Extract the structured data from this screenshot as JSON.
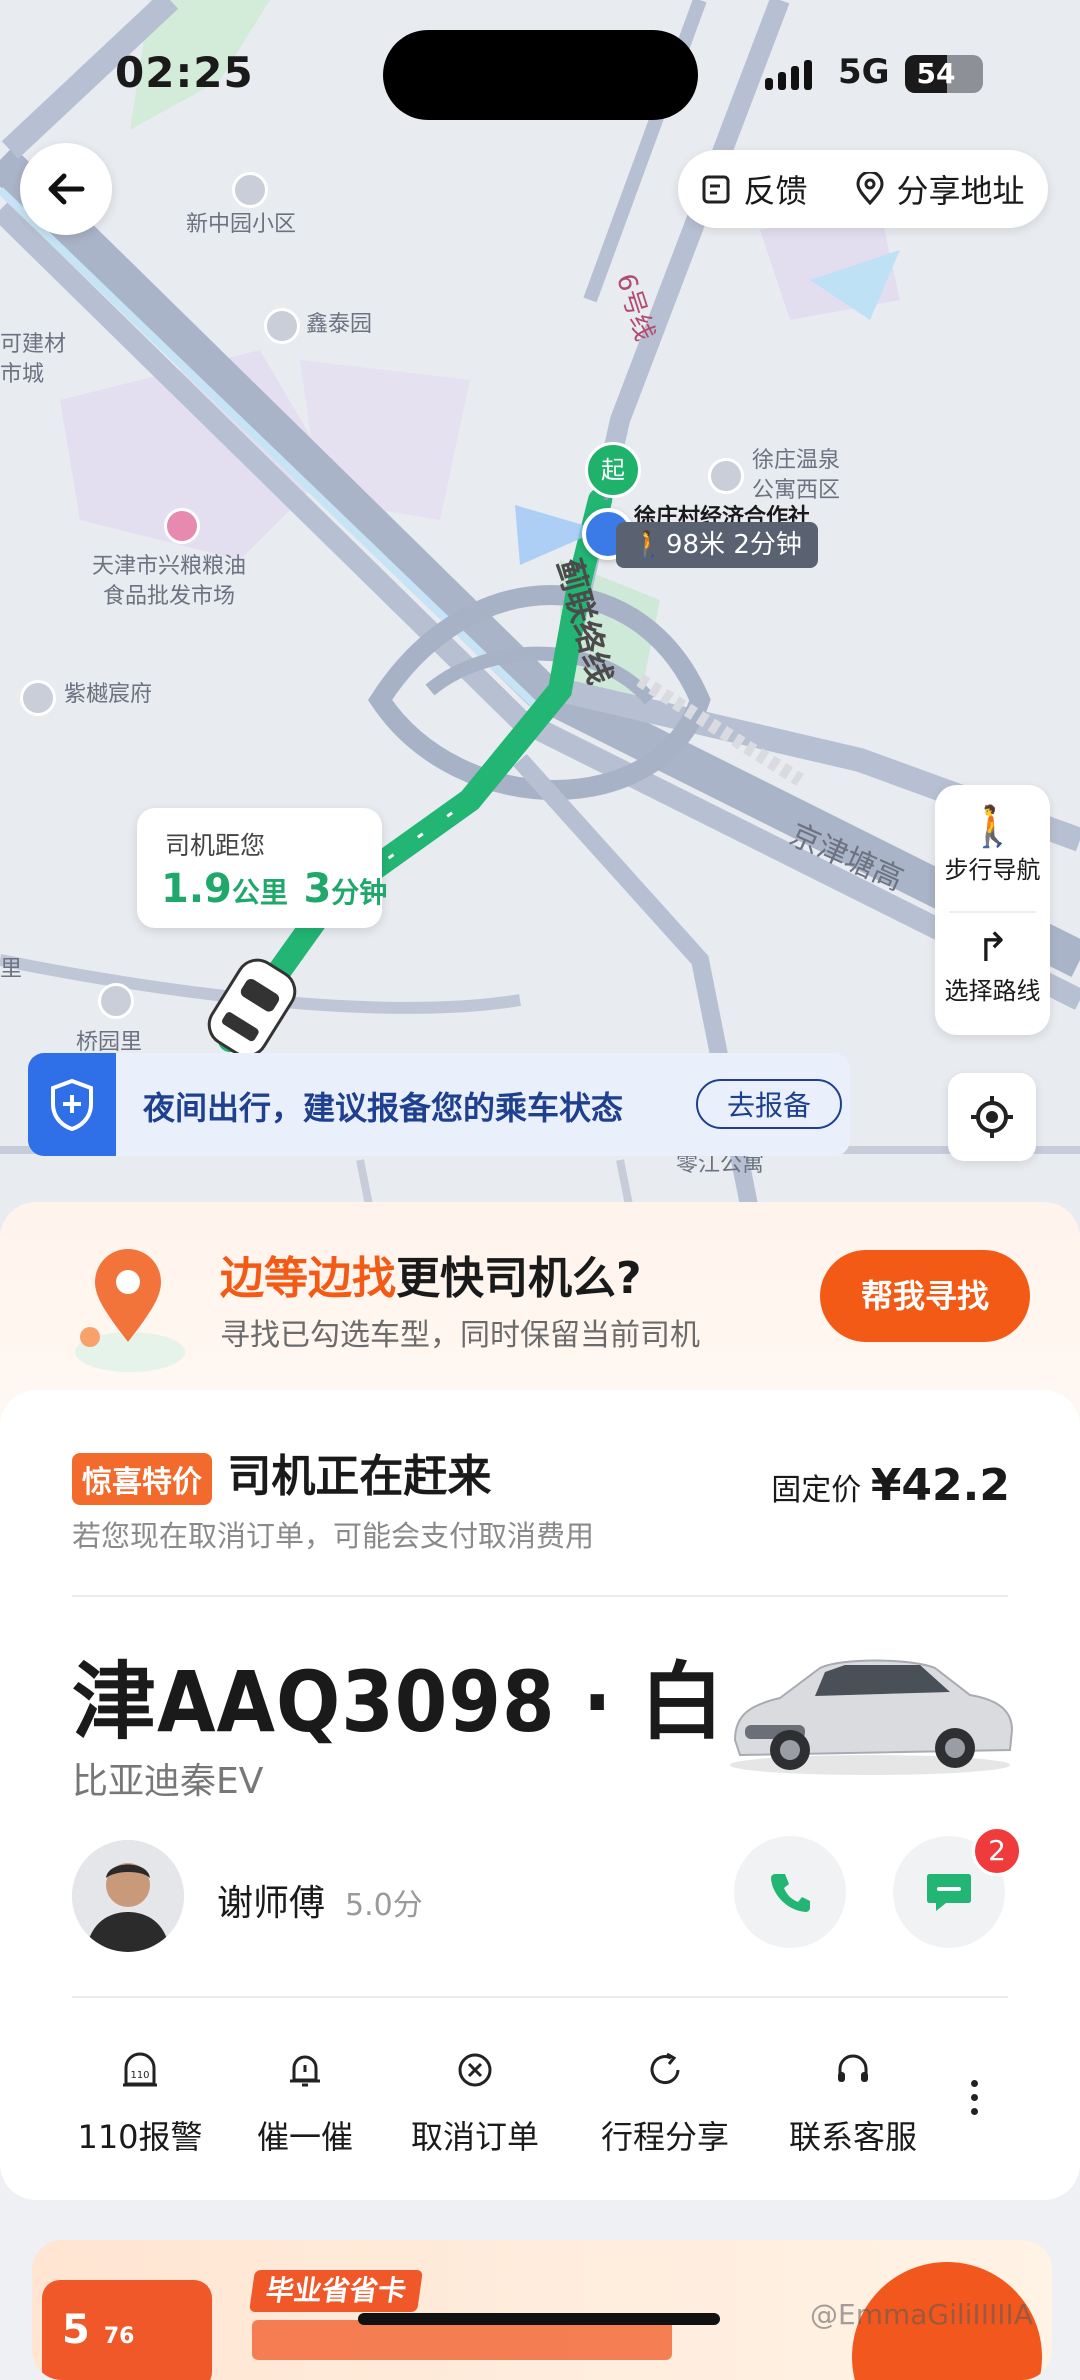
{
  "status_bar": {
    "time": "02:25",
    "network": "5G",
    "battery": "54",
    "battery_level": 0.54
  },
  "top_actions": {
    "feedback": "反馈",
    "share_address": "分享地址"
  },
  "map": {
    "labels": {
      "xinzhongyuan": "新中园小区",
      "xintaiyuan": "鑫泰园",
      "jiancai": "可建材\n市城",
      "xingjiliang": "天津市兴粮粮油\n食品批发市场",
      "zishuchenfu": "紫樾宸府",
      "xuzhuang_wenquan": "徐庄温泉\n公寓西区",
      "xuzhuang_coop": "徐庄村经济合作社",
      "qiaoyuanli": "桥园里",
      "li": "里",
      "line6": "6号线",
      "jilian": "蓟联络线",
      "jingjintang": "京津塘高",
      "bottom_label": "零江公寓"
    },
    "start_marker": "起",
    "walk_info": "98米 2分钟",
    "driver_bubble": {
      "title": "司机距您",
      "distance": "1.9",
      "distance_unit": "公里",
      "eta": "3",
      "eta_unit": "分钟"
    },
    "side_panel": {
      "walk_nav": "步行导航",
      "route": "选择路线"
    },
    "night_banner": {
      "text": "夜间出行，建议报备您的乘车状态",
      "button": "去报备"
    }
  },
  "promo": {
    "highlight": "边等边找",
    "title_rest": "更快司机么?",
    "subtitle": "寻找已勾选车型，同时保留当前司机",
    "button": "帮我寻找"
  },
  "order": {
    "tag": "惊喜特价",
    "status": "司机正在赶来",
    "note": "若您现在取消订单，可能会支付取消费用",
    "price_label": "固定价",
    "price": "¥42.2",
    "plate": "津AAQ3098 · 白",
    "car_model": "比亚迪秦EV",
    "driver_name": "谢师傅",
    "driver_score": "5.0分",
    "message_badge": "2",
    "actions": [
      {
        "icon": "110",
        "label": "110报警"
      },
      {
        "label": "催一催"
      },
      {
        "label": "取消订单"
      },
      {
        "label": "行程分享"
      },
      {
        "label": "联系客服"
      }
    ]
  },
  "bottom_banner": {
    "tag": "毕业省省卡",
    "left_text": "5",
    "small": "76"
  },
  "watermark": "@EmmaGiliIIIIIA",
  "colors": {
    "accent_orange": "#f25a15",
    "green_route": "#22b573",
    "blue": "#2f6fe8"
  }
}
